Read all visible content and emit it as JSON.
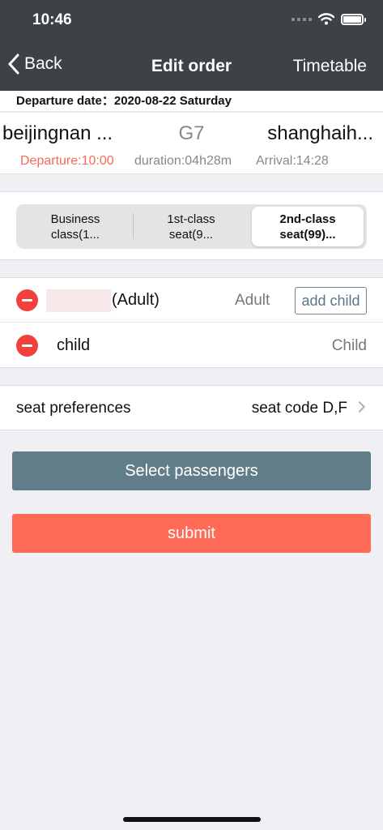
{
  "status_bar": {
    "time": "10:46"
  },
  "nav": {
    "back_label": "Back",
    "back_icon": "chevron-left-icon",
    "title": "Edit order",
    "right_label": "Timetable"
  },
  "trip": {
    "date_line": "Departure date：2020-08-22 Saturday",
    "from_station": "beijingnan ...",
    "train_no": "G7",
    "to_station": "shanghaih...",
    "departure": "Departure:10:00",
    "duration": "duration:04h28m",
    "arrival": "Arrival:14:28"
  },
  "seat_classes": [
    {
      "line1": "Business",
      "line2": "class(1..."
    },
    {
      "line1": "1st-class",
      "line2": "seat(9..."
    },
    {
      "line1": "2nd-class",
      "line2": "seat(99)..."
    }
  ],
  "selected_seat_class": 2,
  "passengers": [
    {
      "name": "(Adult)",
      "type": "Adult",
      "action": "add child"
    },
    {
      "name": "child",
      "type": "Child"
    }
  ],
  "seat_preferences": {
    "label": "seat preferences",
    "value": "seat code D,F"
  },
  "buttons": {
    "select_passengers": "Select passengers",
    "submit": "submit"
  },
  "colors": {
    "header_bg": "#3d4246",
    "departure": "#f46b55",
    "remove": "#f2403d",
    "select_btn": "#627d8a",
    "submit_btn": "#ff6b57"
  }
}
